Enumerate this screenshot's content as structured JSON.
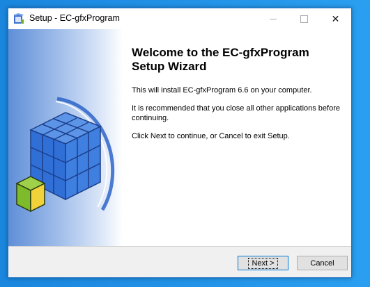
{
  "window": {
    "title": "Setup - EC-gfxProgram",
    "minimize_icon": "minimize-icon",
    "maximize_icon": "maximize-icon",
    "close_icon": "close-icon",
    "close_glyph": "✕"
  },
  "wizard": {
    "heading": "Welcome to the EC-gfxProgram Setup Wizard",
    "paragraphs": [
      "This will install EC-gfxProgram 6.6 on your computer.",
      "It is recommended that you close all other applications before continuing.",
      "Click Next to continue, or Cancel to exit Setup."
    ]
  },
  "buttons": {
    "next_label": "Next >",
    "cancel_label": "Cancel"
  },
  "colors": {
    "accent": "#0078d7",
    "cube_blue": "#2f6fd6",
    "cube_yellow": "#f2d23a",
    "cube_green": "#7dbb2a"
  }
}
